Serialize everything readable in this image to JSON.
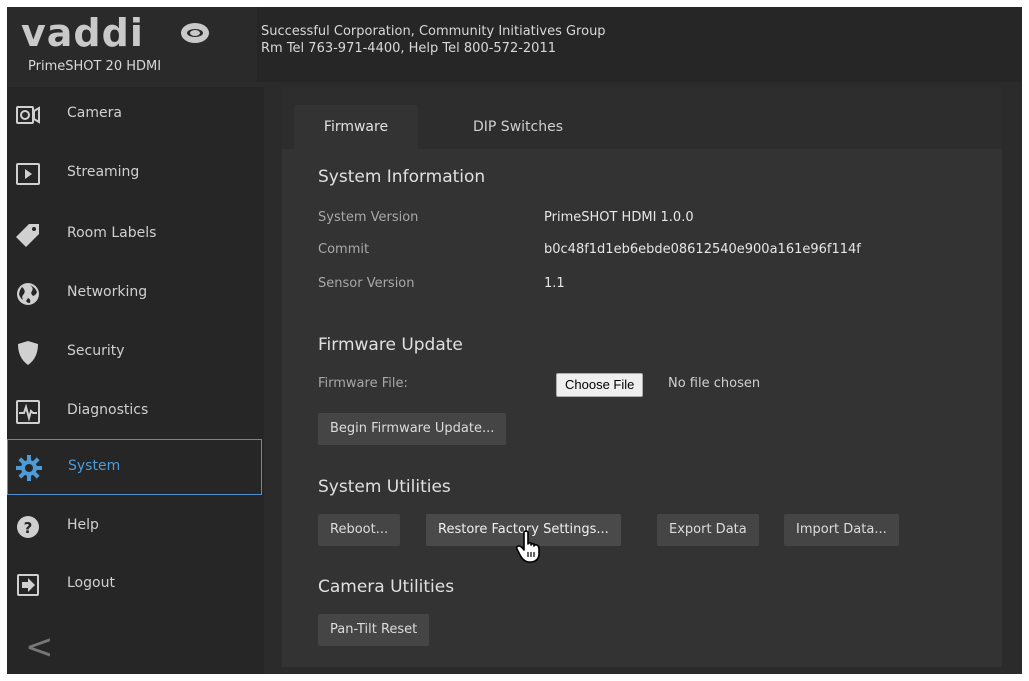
{
  "brand": {
    "logo_text": "vaddi",
    "model": "PrimeSHOT 20 HDMI",
    "company_line1": "Successful Corporation, Community Initiatives Group",
    "company_line2": "Rm Tel 763-971-4400, Help Tel 800-572-2011"
  },
  "sidebar": {
    "items": [
      {
        "label": "Camera",
        "icon": "camera-icon"
      },
      {
        "label": "Streaming",
        "icon": "play-icon"
      },
      {
        "label": "Room Labels",
        "icon": "tag-icon"
      },
      {
        "label": "Networking",
        "icon": "globe-icon"
      },
      {
        "label": "Security",
        "icon": "shield-icon"
      },
      {
        "label": "Diagnostics",
        "icon": "pulse-icon"
      },
      {
        "label": "System",
        "icon": "gear-icon",
        "active": true
      },
      {
        "label": "Help",
        "icon": "help-icon"
      },
      {
        "label": "Logout",
        "icon": "logout-icon"
      }
    ],
    "collapse": "<"
  },
  "tabs": [
    {
      "label": "Firmware",
      "active": true
    },
    {
      "label": "DIP Switches",
      "active": false
    }
  ],
  "system_info": {
    "title": "System Information",
    "rows": [
      {
        "label": "System Version",
        "value": "PrimeSHOT HDMI 1.0.0"
      },
      {
        "label": "Commit",
        "value": "b0c48f1d1eb6ebde08612540e900a161e96f114f"
      },
      {
        "label": "Sensor Version",
        "value": "1.1"
      }
    ]
  },
  "firmware_update": {
    "title": "Firmware Update",
    "file_label": "Firmware File:",
    "choose_file": "Choose File",
    "no_file": "No file chosen",
    "begin_button": "Begin Firmware Update..."
  },
  "system_utilities": {
    "title": "System Utilities",
    "reboot": "Reboot...",
    "restore": "Restore Factory Settings...",
    "export": "Export Data",
    "import": "Import Data..."
  },
  "camera_utilities": {
    "title": "Camera Utilities",
    "pan_tilt_reset": "Pan-Tilt Reset"
  },
  "colors": {
    "accent": "#4e9bd8",
    "background": "#2b2b2b",
    "panel": "#333333",
    "button": "#454545"
  }
}
